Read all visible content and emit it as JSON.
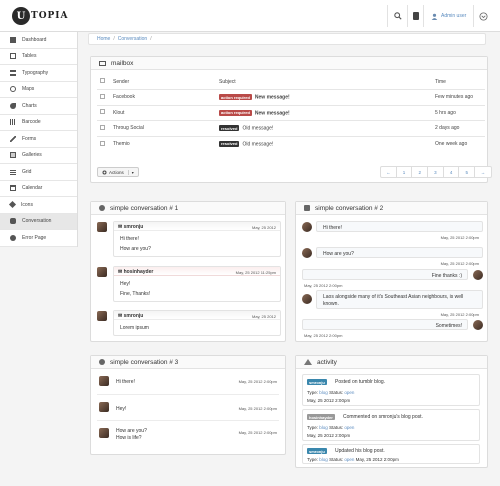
{
  "app": {
    "logo_letter": "U",
    "logo_text": "TOPIA",
    "user_label": "Admin user"
  },
  "breadcrumb": {
    "home": "Home",
    "current": "Conversation",
    "sep1": "/",
    "sep2": "/"
  },
  "sidebar": {
    "items": [
      {
        "label": "Dashboard"
      },
      {
        "label": "Tables"
      },
      {
        "label": "Typography"
      },
      {
        "label": "Maps"
      },
      {
        "label": "Charts"
      },
      {
        "label": "Barcode"
      },
      {
        "label": "Forms"
      },
      {
        "label": "Galleries"
      },
      {
        "label": "Grid"
      },
      {
        "label": "Calendar"
      },
      {
        "label": "Icons"
      },
      {
        "label": "Conversation"
      },
      {
        "label": "Error Page"
      }
    ]
  },
  "mailbox": {
    "title": "mailbox",
    "headers": {
      "sender": "Sender",
      "subject": "Subject",
      "time": "Time"
    },
    "rows": [
      {
        "sender": "Facebook",
        "label": "action required",
        "subject": "New message!",
        "time": "Few minutes ago"
      },
      {
        "sender": "Klout",
        "label": "action required",
        "subject": "New message!",
        "time": "5 hrs ago"
      },
      {
        "sender": "Throug Social",
        "label": "resolved",
        "subject": "Old message!",
        "time": "2 days ago"
      },
      {
        "sender": "Themio",
        "label": "resolved",
        "subject": "Old message!",
        "time": "One week ago"
      }
    ],
    "actions_label": "Actions",
    "pager": [
      "←",
      "1",
      "2",
      "3",
      "4",
      "5",
      "→"
    ]
  },
  "conv1": {
    "title": "simple conversation # 1",
    "messages": [
      {
        "author": "smronju",
        "time": "May, 25 2012",
        "lines": [
          "Hi there!",
          "How are you?"
        ]
      },
      {
        "author": "hosinhayder",
        "time": "May, 25 2012 11:25pm",
        "lines": [
          "Hey!",
          "Fine, Thanks!"
        ]
      },
      {
        "author": "smronju",
        "time": "May, 25 2012",
        "lines": [
          "Lorem ipsum"
        ]
      }
    ]
  },
  "conv2": {
    "title": "simple conversation # 2",
    "messages": [
      {
        "text": "Hi there!",
        "time": "May, 25 2012 2:00pm"
      },
      {
        "text": "How are you?",
        "time": "May, 25 2012 2:00pm"
      },
      {
        "text": "Fine thanks :)",
        "time": "May, 25 2012 2:00pm"
      },
      {
        "text": "Laos alongside many of it's Southeast Asian neighbours, is well known.",
        "time": "May, 25 2012 2:00pm"
      },
      {
        "text": "Sometimes!",
        "time": "May, 25 2012 2:00pm"
      }
    ]
  },
  "conv3": {
    "title": "simple conversation # 3",
    "messages": [
      {
        "lines": [
          "Hi there!"
        ],
        "time": "May, 25 2012 2:00pm"
      },
      {
        "lines": [
          "Hey!"
        ],
        "time": "May, 25 2012 2:00pm"
      },
      {
        "lines": [
          "How are you?",
          "How is life?"
        ],
        "time": "May, 25 2012 2:00pm"
      }
    ]
  },
  "activity": {
    "title": "activity",
    "items": [
      {
        "badge": "smronju",
        "text": "Posted on tumblr blog.",
        "type_label": "Type:",
        "type": "blog",
        "status_label": "Status:",
        "status": "open",
        "time": "May, 25 2012 2:00pm"
      },
      {
        "badge": "hosinhayder",
        "text": "Commented on smronju's blog post.",
        "type_label": "Type:",
        "type": "blog",
        "status_label": "Status:",
        "status": "open",
        "time": "May, 25 2012 2:00pm"
      },
      {
        "badge": "smronju",
        "text": "Updated his blog post.",
        "type_label": "Type:",
        "type": "blog",
        "status_label": "Status:",
        "status": "open",
        "time": "May, 25 2012 2:00pm"
      }
    ]
  },
  "colors": {
    "accent_link": "#5a8bbf",
    "label_red": "#b94a48",
    "label_dark": "#333333"
  }
}
